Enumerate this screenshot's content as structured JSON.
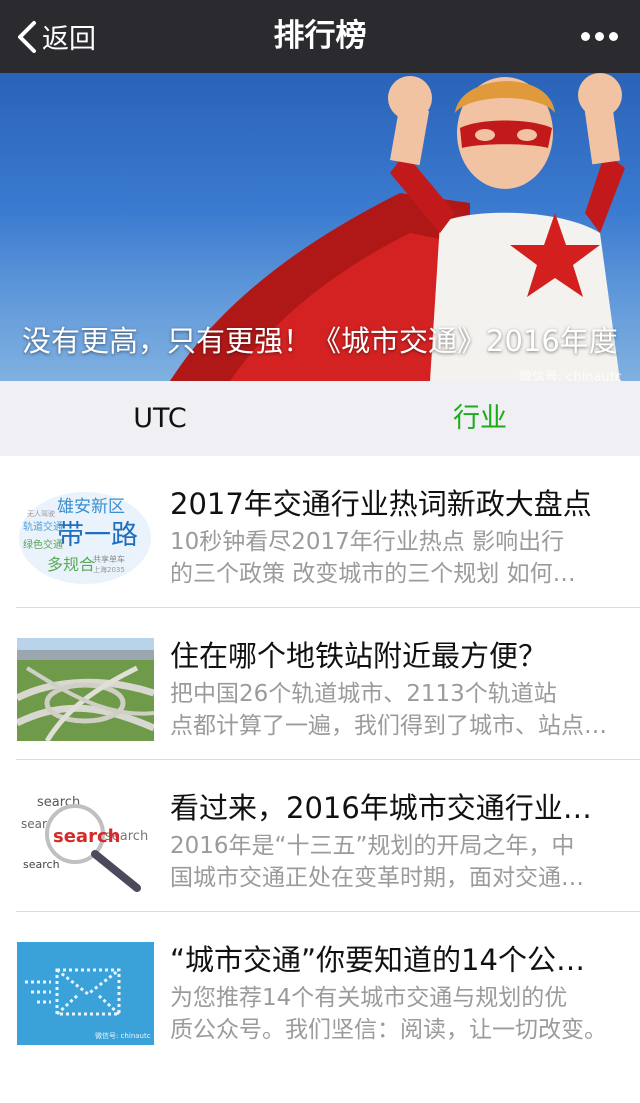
{
  "navbar": {
    "back_label": "返回",
    "title": "排行榜"
  },
  "banner": {
    "caption": "没有更高，只有更强！《城市交通》2016年度",
    "watermark": "微信号: chinautc"
  },
  "tabs": [
    {
      "label": "UTC",
      "active": false
    },
    {
      "label": "行业",
      "active": true
    }
  ],
  "articles": [
    {
      "title": "2017年交通行业热词新政大盘点",
      "desc_line1": "10秒钟看尽2017年行业热点 影响出行",
      "desc_line2": "的三个政策 改变城市的三个规划 如何…",
      "thumb": {
        "type": "wordcloud",
        "words": [
          "雄安新区",
          "带一路",
          "轨道交通",
          "绿色交通",
          "多规合",
          "共享单车",
          "无人驾驶",
          "上海2035"
        ]
      }
    },
    {
      "title": "住在哪个地铁站附近最方便？",
      "desc_line1": "把中国26个轨道城市、2113个轨道站",
      "desc_line2": "点都计算了一遍，我们得到了城市、站点…",
      "thumb": {
        "type": "interchange"
      }
    },
    {
      "title": "看过来，2016年城市交通行业热词",
      "desc_line1": "2016年是“十三五”规划的开局之年，中",
      "desc_line2": "国城市交通正处在变革时期，面对交通…",
      "thumb": {
        "type": "search",
        "words": [
          "search",
          "search",
          "search",
          "search",
          "search"
        ]
      }
    },
    {
      "title": "“城市交通”你要知道的14个公众号",
      "desc_line1": "为您推荐14个有关城市交通与规划的优",
      "desc_line2": "质公众号。我们坚信：阅读，让一切改变。",
      "thumb": {
        "type": "envelope",
        "watermark": "微信号: chinautc"
      }
    }
  ],
  "colors": {
    "navbar": "#2b2b2f",
    "tab_active": "#1aad19",
    "tab_bg": "#efeff4",
    "desc": "#9b9b9b"
  }
}
